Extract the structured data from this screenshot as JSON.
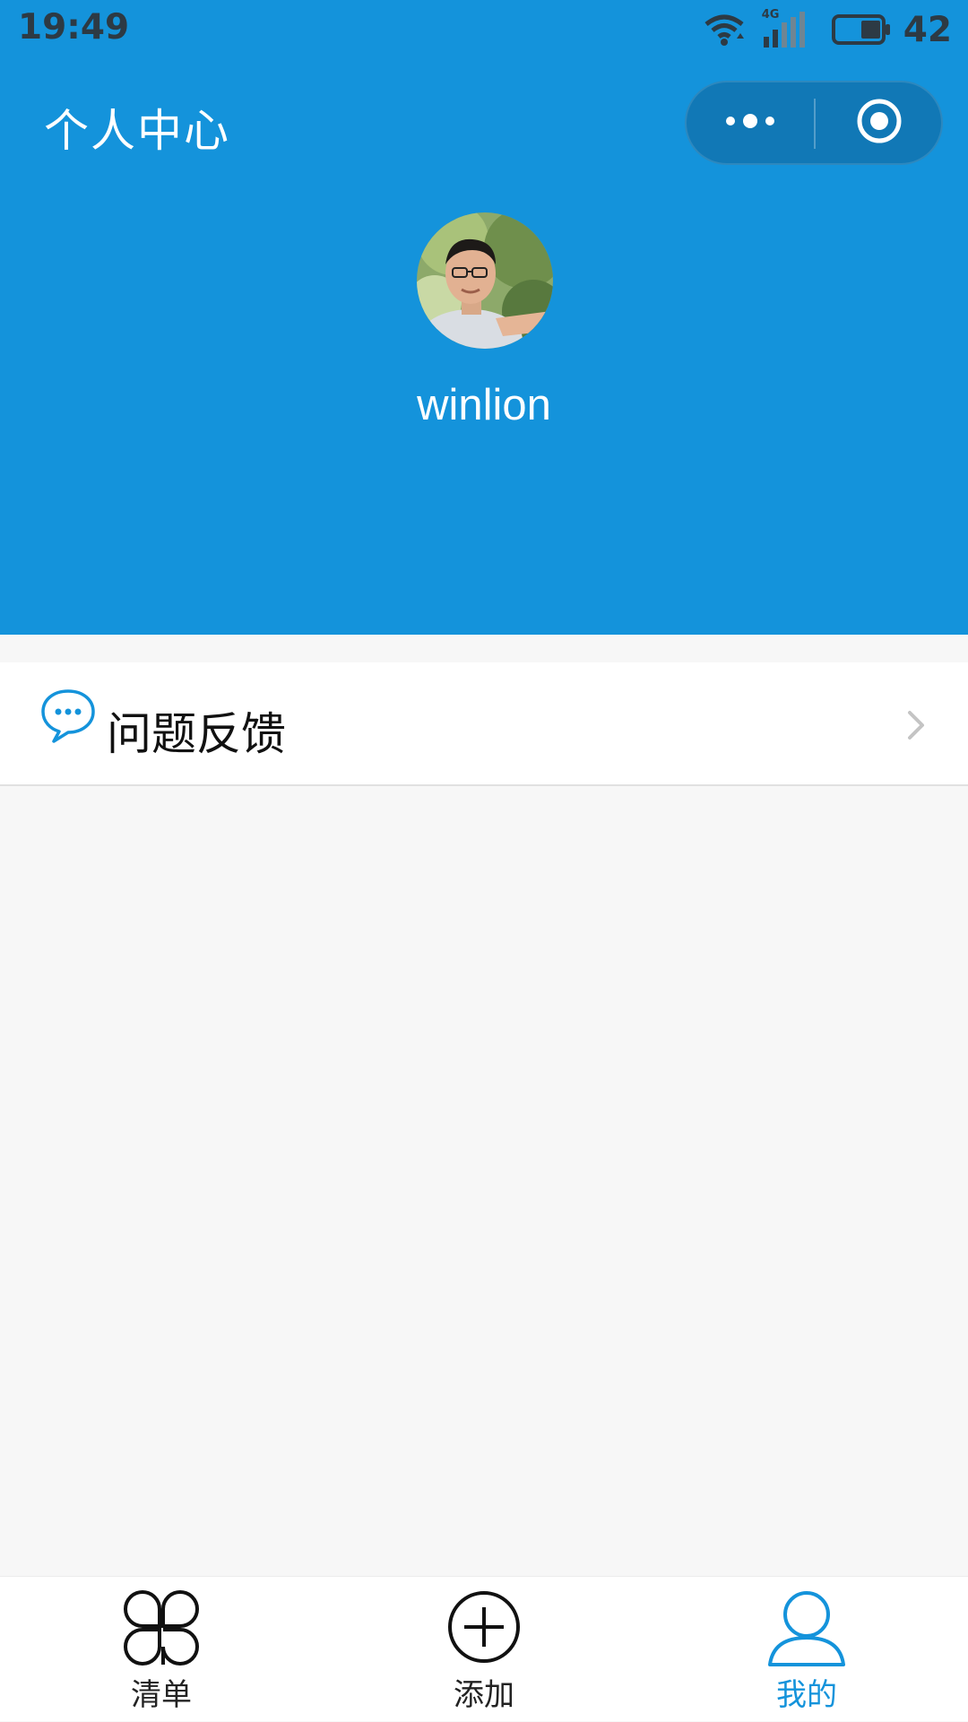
{
  "status_bar": {
    "time": "19:49",
    "network": "4G",
    "battery_percent": "42",
    "icons": [
      "wifi-icon",
      "signal-icon",
      "battery-icon"
    ]
  },
  "header": {
    "title": "个人中心",
    "background_color": "#1493db",
    "capsule": {
      "more_icon": "more-dots-icon",
      "close_icon": "target-circle-icon"
    }
  },
  "profile": {
    "avatar": "user-photo",
    "username": "winlion"
  },
  "menu": [
    {
      "icon": "chat-bubble-icon",
      "label": "问题反馈",
      "trailing_icon": "chevron-right-icon"
    }
  ],
  "tabbar": {
    "active_color": "#1493db",
    "tabs": [
      {
        "label": "清单",
        "icon": "clover-icon",
        "active": false
      },
      {
        "label": "添加",
        "icon": "plus-circle-icon",
        "active": false
      },
      {
        "label": "我的",
        "icon": "person-icon",
        "active": true
      }
    ]
  }
}
